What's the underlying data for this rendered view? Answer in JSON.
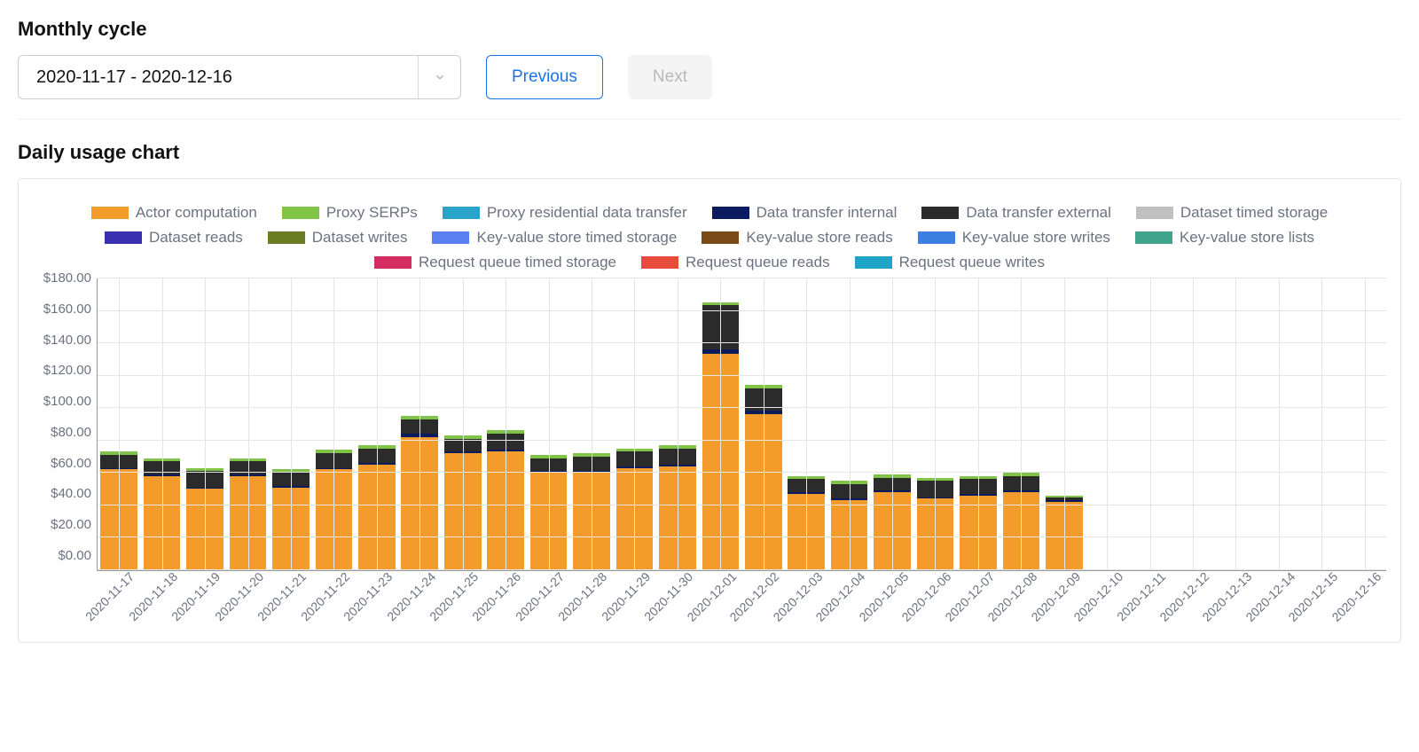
{
  "header": {
    "monthly_cycle_label": "Monthly cycle",
    "selected_range": "2020-11-17 - 2020-12-16",
    "prev_label": "Previous",
    "next_label": "Next"
  },
  "chart_title": "Daily usage chart",
  "y_ticks": [
    "$180.00",
    "$160.00",
    "$140.00",
    "$120.00",
    "$100.00",
    "$80.00",
    "$60.00",
    "$40.00",
    "$20.00",
    "$0.00"
  ],
  "legend": [
    {
      "name": "Actor computation",
      "color": "#f39c2c"
    },
    {
      "name": "Proxy SERPs",
      "color": "#7fc447"
    },
    {
      "name": "Proxy residential data transfer",
      "color": "#2aa3c9"
    },
    {
      "name": "Data transfer internal",
      "color": "#0a1a5e"
    },
    {
      "name": "Data transfer external",
      "color": "#2b2b2b"
    },
    {
      "name": "Dataset timed storage",
      "color": "#c0c0c0"
    },
    {
      "name": "Dataset reads",
      "color": "#3a2fb0"
    },
    {
      "name": "Dataset writes",
      "color": "#6a7d22"
    },
    {
      "name": "Key-value store timed storage",
      "color": "#5a7ff0"
    },
    {
      "name": "Key-value store reads",
      "color": "#7a4a16"
    },
    {
      "name": "Key-value store writes",
      "color": "#3b7fe0"
    },
    {
      "name": "Key-value store lists",
      "color": "#3fa38d"
    },
    {
      "name": "Request queue timed storage",
      "color": "#d42d64"
    },
    {
      "name": "Request queue reads",
      "color": "#e84b3c"
    },
    {
      "name": "Request queue writes",
      "color": "#1fa3c6"
    }
  ],
  "chart_data": {
    "type": "bar",
    "stacked": true,
    "title": "Daily usage chart",
    "xlabel": "",
    "ylabel": "",
    "ylim": [
      0,
      180
    ],
    "y_tick_interval": 20,
    "currency_prefix": "$",
    "categories": [
      "2020-11-17",
      "2020-11-18",
      "2020-11-19",
      "2020-11-20",
      "2020-11-21",
      "2020-11-22",
      "2020-11-23",
      "2020-11-24",
      "2020-11-25",
      "2020-11-26",
      "2020-11-27",
      "2020-11-28",
      "2020-11-29",
      "2020-11-30",
      "2020-12-01",
      "2020-12-02",
      "2020-12-03",
      "2020-12-04",
      "2020-12-05",
      "2020-12-06",
      "2020-12-07",
      "2020-12-08",
      "2020-12-09",
      "2020-12-10",
      "2020-12-11",
      "2020-12-12",
      "2020-12-13",
      "2020-12-14",
      "2020-12-15",
      "2020-12-16"
    ],
    "series": [
      {
        "name": "Actor computation",
        "color": "#f39c2c",
        "values": [
          62,
          58,
          50,
          58,
          51,
          62,
          65,
          82,
          72,
          73,
          60,
          60,
          63,
          64,
          133,
          96,
          47,
          43,
          48,
          44,
          46,
          48,
          42,
          0,
          0,
          0,
          0,
          0,
          0,
          0
        ]
      },
      {
        "name": "Data transfer internal",
        "color": "#0a1a5e",
        "values": [
          1,
          1,
          1,
          1,
          1,
          1,
          1,
          2,
          1,
          1,
          1,
          1,
          1,
          1,
          3,
          2,
          1,
          1,
          1,
          1,
          1,
          1,
          1,
          0,
          0,
          0,
          0,
          0,
          0,
          0
        ]
      },
      {
        "name": "Data transfer external",
        "color": "#2b2b2b",
        "values": [
          8,
          8,
          10,
          8,
          8,
          9,
          9,
          9,
          8,
          10,
          8,
          9,
          9,
          10,
          27,
          14,
          8,
          9,
          8,
          10,
          9,
          9,
          2,
          0,
          0,
          0,
          0,
          0,
          0,
          0
        ]
      },
      {
        "name": "Proxy SERPs",
        "color": "#7fc447",
        "values": [
          2,
          2,
          2,
          2,
          2,
          2,
          2,
          2,
          2,
          2,
          2,
          2,
          2,
          2,
          2,
          2,
          2,
          2,
          2,
          2,
          2,
          2,
          1,
          0,
          0,
          0,
          0,
          0,
          0,
          0
        ]
      }
    ]
  }
}
